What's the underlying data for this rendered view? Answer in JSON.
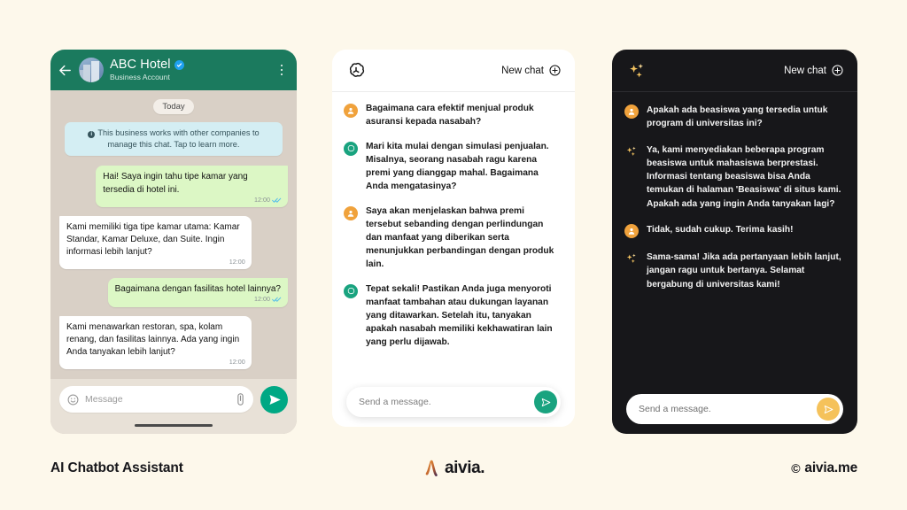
{
  "background_color": "#FDF8EB",
  "whatsapp": {
    "header": {
      "back_icon": "arrow-left-icon",
      "avatar_icon": "hotel-building-avatar",
      "title": "ABC Hotel",
      "verified_icon": "verified-badge-icon",
      "subtitle": "Business Account",
      "menu_icon": "overflow-menu-icon",
      "bg_color": "#1B7A5E"
    },
    "day_divider": "Today",
    "business_notice": "This business works with other companies to manage this chat. Tap to learn more.",
    "notice_icon": "info-icon",
    "messages": [
      {
        "side": "out",
        "text": "Hai! Saya ingin tahu tipe kamar yang tersedia di hotel ini.",
        "time": "12:00",
        "ticks": true
      },
      {
        "side": "in",
        "text": "Kami memiliki tiga tipe kamar utama: Kamar Standar, Kamar Deluxe, dan Suite. Ingin informasi lebih lanjut?",
        "time": "12:00",
        "ticks": false
      },
      {
        "side": "out",
        "text": "Bagaimana dengan fasilitas hotel lainnya?",
        "time": "12:00",
        "ticks": true
      },
      {
        "side": "in",
        "text": "Kami menawarkan restoran, spa, kolam renang, dan fasilitas lainnya. Ada yang ingin Anda tanyakan lebih lanjut?",
        "time": "12:00",
        "ticks": false
      }
    ],
    "composer": {
      "emoji_icon": "emoji-smiley-icon",
      "placeholder": "Message",
      "attach_icon": "paperclip-icon",
      "send_icon": "send-paper-plane-icon",
      "send_color": "#00A884"
    }
  },
  "chatgpt": {
    "header": {
      "logo_icon": "openai-logo-icon",
      "new_chat_label": "New chat",
      "new_chat_icon": "plus-circle-icon"
    },
    "messages": [
      {
        "role": "user",
        "avatar_icon": "user-avatar-icon",
        "text": "Bagaimana cara efektif menjual produk asuransi kepada nasabah?"
      },
      {
        "role": "bot",
        "avatar_icon": "openai-bot-avatar-icon",
        "text": "Mari kita mulai dengan simulasi penjualan. Misalnya, seorang nasabah ragu karena premi yang dianggap mahal. Bagaimana Anda mengatasinya?"
      },
      {
        "role": "user",
        "avatar_icon": "user-avatar-icon",
        "text": "Saya akan menjelaskan bahwa premi tersebut sebanding dengan perlindungan dan manfaat yang diberikan serta menunjukkan perbandingan dengan produk lain."
      },
      {
        "role": "bot",
        "avatar_icon": "openai-bot-avatar-icon",
        "text": "Tepat sekali! Pastikan Anda juga menyoroti manfaat tambahan atau dukungan layanan yang ditawarkan. Setelah itu, tanyakan apakah nasabah memiliki kekhawatiran lain yang perlu dijawab."
      }
    ],
    "composer": {
      "placeholder": "Send a message.",
      "send_icon": "send-paper-plane-icon",
      "send_color": "#19A37F"
    }
  },
  "dark_assistant": {
    "header": {
      "logo_icon": "sparkles-icon",
      "new_chat_label": "New chat",
      "new_chat_icon": "plus-circle-icon",
      "bg_color": "#17171A"
    },
    "messages": [
      {
        "role": "user",
        "avatar_icon": "user-avatar-icon",
        "text": "Apakah ada beasiswa yang tersedia untuk program di universitas ini?"
      },
      {
        "role": "bot",
        "avatar_icon": "sparkles-icon",
        "text": "Ya, kami menyediakan beberapa program beasiswa untuk mahasiswa berprestasi. Informasi tentang beasiswa bisa Anda temukan di halaman 'Beasiswa' di situs kami. Apakah ada yang ingin Anda tanyakan lagi?"
      },
      {
        "role": "user",
        "avatar_icon": "user-avatar-icon",
        "text": "Tidak, sudah cukup. Terima kasih!"
      },
      {
        "role": "bot",
        "avatar_icon": "sparkles-icon",
        "text": "Sama-sama! Jika ada pertanyaan lebih lanjut, jangan ragu untuk bertanya. Selamat bergabung di universitas kami!"
      }
    ],
    "composer": {
      "placeholder": "Send a message.",
      "send_icon": "send-paper-plane-icon",
      "send_color": "#F5C25B"
    }
  },
  "captions": {
    "left": "AI Chatbot Assistant",
    "center_logo_icon": "aivia-lambda-mark",
    "center": "aivia.",
    "right_symbol": "©",
    "right": "aivia.me"
  }
}
